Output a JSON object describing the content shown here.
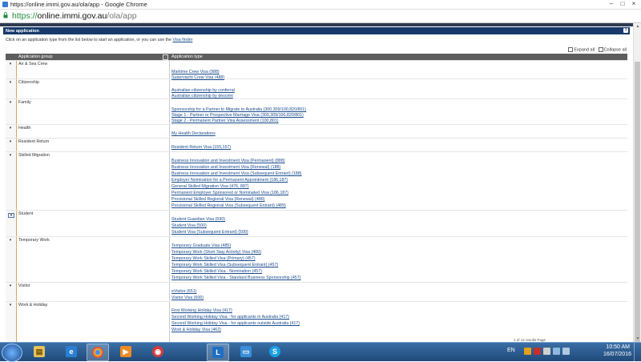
{
  "window": {
    "title": "https://online.immi.gov.au/ola/app - Google Chrome",
    "controls": {
      "minimize": "–",
      "maximize": "□",
      "close": "×"
    }
  },
  "address": {
    "scheme": "https://",
    "host": "online.immi.gov.au",
    "path": "/ola/app"
  },
  "panel": {
    "title": "New application",
    "help": "?",
    "instruction_prefix": "Click on an application type from the list below to start an application, or you can use the ",
    "visa_finder": "Visa finder",
    "expand_all": "Expand all",
    "collapse_all": "Collapse all"
  },
  "table": {
    "col_group": "Application group",
    "col_type": "Application type",
    "groups": [
      {
        "name": "Air & Sea Crew",
        "types": [
          "Maritime Crew Visa (988)",
          "Superyacht Crew Visa (488)"
        ]
      },
      {
        "name": "Citizenship",
        "types": [
          "Australian citizenship by conferral",
          "Australian citizenship by descent"
        ]
      },
      {
        "name": "Family",
        "types": [
          "Sponsorship for a Partner to Migrate to Australia (300,309/100,820/801)",
          "Stage 1 - Partner or Prospective Marriage Visa (300,309/100,820/801)",
          "Stage 2 - Permanent Partner Visa Assessment (100,801)"
        ]
      },
      {
        "name": "Health",
        "types": [
          "My Health Declarations"
        ]
      },
      {
        "name": "Resident Return",
        "types": [
          "Resident Return Visa (155,157)"
        ]
      },
      {
        "name": "Skilled Migration",
        "types": [
          "Business Innovation and Investment Visa (Permanent) (888)",
          "Business Innovation and Investment Visa (Renewal) (188)",
          "Business Innovation and Investment Visa (Subsequent Entrant) (188)",
          "Employer Nomination for a Permanent Appointment (186,187)",
          "General Skilled Migration Visa (476, 887)",
          "Permanent Employer Sponsored or Nominated Visa (186,187)",
          "Provisional Skilled Regional Visa (Renewal) (489)",
          "Provisional Skilled Regional Visa (Subsequent Entrant) (489)"
        ]
      },
      {
        "name": "Student",
        "types": [
          "Student Guardian Visa (590)",
          "Student Visa (500)",
          "Student Visa (Subsequent Entrant) (500)"
        ]
      },
      {
        "name": "Temporary Work",
        "types": [
          "Temporary Graduate Visa (485)",
          "Temporary Work (Short Stay Activity) Visa (400)",
          "Temporary Work Skilled Visa (Primary) (457)",
          "Temporary Work Skilled Visa (Subsequent Entrant) (457)",
          "Temporary Work Skilled Visa - Nomination (457)",
          "Temporary Work Skilled Visa - Standard Business Sponsorship (457)"
        ]
      },
      {
        "name": "Visitor",
        "types": [
          "eVisitor (651)",
          "Visitor Visa (600)"
        ]
      },
      {
        "name": "Work & Holiday",
        "types": [
          "First Working Holiday Visa (417)",
          "Second Working Holiday Visa - for applicants in Australia (417)",
          "Second Working Holiday Visa - for applicants outside Australia (417)",
          "Work & Holiday Visa (462)"
        ]
      }
    ]
  },
  "pager_text": "1 of 12 results  Page",
  "taskbar": {
    "apps": [
      "file-explorer",
      "internet-explorer",
      "chrome",
      "media-player",
      "ubuntu",
      "lync",
      "folder",
      "skype"
    ],
    "lang": "EN",
    "time": "10:50 AM",
    "date": "16/07/2016"
  }
}
